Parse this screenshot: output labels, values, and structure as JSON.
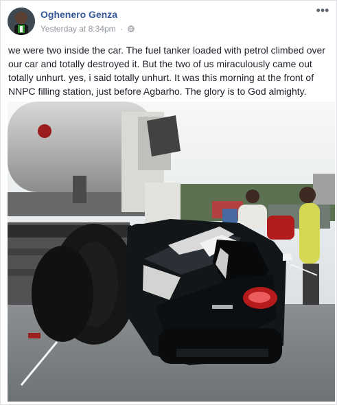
{
  "post": {
    "author": "Oghenero Genza",
    "timestamp": "Yesterday at 8:34pm",
    "separator": "·",
    "audience_icon": "globe-icon",
    "menu_icon": "ellipsis-icon",
    "text": "we were two inside the car. The fuel tanker loaded with petrol climbed over our car and totally destroyed it. But the two of us miraculously came out totally unhurt. yes, i said totally unhurt. It was this morning at the front of NNPC filling station, just before Agbarho. The glory is to God almighty."
  },
  "colors": {
    "author_link": "#365899",
    "meta_text": "#90949c",
    "body_text": "#1d2129",
    "border": "#dddfe2"
  }
}
